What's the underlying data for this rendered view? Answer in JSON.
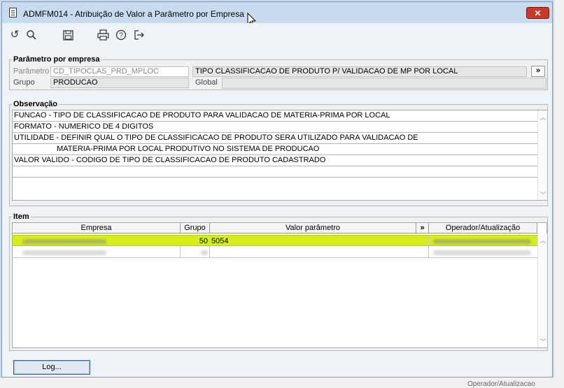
{
  "window": {
    "title": "ADMFM014 - Atribuição de Valor a Parâmetro por Empresa",
    "close_label": "✕"
  },
  "toolbar": {
    "icons": [
      "undo-icon",
      "search-icon",
      "save-icon",
      "print-icon",
      "help-icon",
      "exit-icon"
    ]
  },
  "parametro_section": {
    "legend": "Parâmetro por empresa",
    "parametro_label": "Parâmetro",
    "parametro_code": "CD_TIPOCLAS_PRD_MPLOC",
    "parametro_desc": "TIPO CLASSIFICACAO DE PRODUTO P/ VALIDACAO DE MP POR LOCAL",
    "expand_label": "»",
    "grupo_label": "Grupo",
    "grupo_value": "PRODUCAO",
    "global_label": "Global",
    "global_value": ""
  },
  "observacao": {
    "legend": "Observação",
    "lines": [
      "FUNCAO - TIPO DE CLASSIFICACAO DE PRODUTO PARA VALIDACAO DE MATERIA-PRIMA POR LOCAL",
      "FORMATO - NUMERICO DE 4 DIGITOS",
      "UTILIDADE - DEFINIR QUAL O TIPO DE CLASSIFICACAO DE PRODUTO SERA UTILIZADO PARA VALIDACAO DE",
      "                    MATERIA-PRIMA POR LOCAL PRODUTIVO NO SISTEMA DE PRODUCAO",
      "VALOR VALIDO - CODIGO DE TIPO DE CLASSIFICACAO DE PRODUTO CADASTRADO",
      ""
    ]
  },
  "item": {
    "legend": "Item",
    "columns": {
      "empresa": "Empresa",
      "grupo": "Grupo",
      "valor": "Valor parâmetro",
      "expand": "»",
      "operador": "Operador/Atualização"
    },
    "rows": [
      {
        "grupo": "50",
        "valor": "5054",
        "selected": true
      },
      {
        "grupo": "",
        "valor": "",
        "selected": false
      }
    ]
  },
  "footer": {
    "log_label": "Log...",
    "background_text": "Operador/Atualizacao"
  },
  "colors": {
    "highlight": "#d6ef1a",
    "title_bar": "#c9dcef",
    "close": "#c8392b"
  }
}
